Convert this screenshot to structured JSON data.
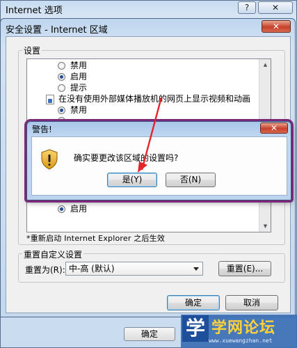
{
  "outer_window": {
    "title": "Internet 选项",
    "help_glyph": "?",
    "close_glyph": "✕",
    "ok_label": "确定"
  },
  "security_dialog": {
    "title": "安全设置 - Internet 区域",
    "close_glyph": "✕",
    "settings_group_label": "设置",
    "settings_items": [
      {
        "kind": "radio",
        "label": "禁用",
        "checked": false
      },
      {
        "kind": "radio",
        "label": "启用",
        "checked": true
      },
      {
        "kind": "radio",
        "label": "提示",
        "checked": false
      },
      {
        "kind": "setting",
        "label": "在没有使用外部媒体播放机的网页上显示视频和动画"
      },
      {
        "kind": "radio",
        "label": "禁用",
        "checked": true
      }
    ],
    "lower_item": {
      "kind": "radio",
      "label": "启用",
      "checked": true
    },
    "restart_note": "*重新启动 Internet Explorer 之后生效",
    "reset_group_label": "重置自定义设置",
    "reset_to_label": "重置为(R):",
    "reset_to_value": "中-高 (默认)",
    "reset_button": "重置(E)...",
    "ok_button": "确定",
    "cancel_button": "取消"
  },
  "warning_dialog": {
    "title": "警告!",
    "message": "确实要更改该区域的设置吗?",
    "yes_button": "是(Y)",
    "no_button": "否(N)",
    "close_glyph": "✕",
    "accent_frame_color": "#7b2a7a"
  },
  "annotation": {
    "arrow_color": "#e3242b"
  },
  "watermark": {
    "logo_char": "学",
    "site_name": "学网论坛",
    "url": "www.xuewangzhan.net"
  }
}
